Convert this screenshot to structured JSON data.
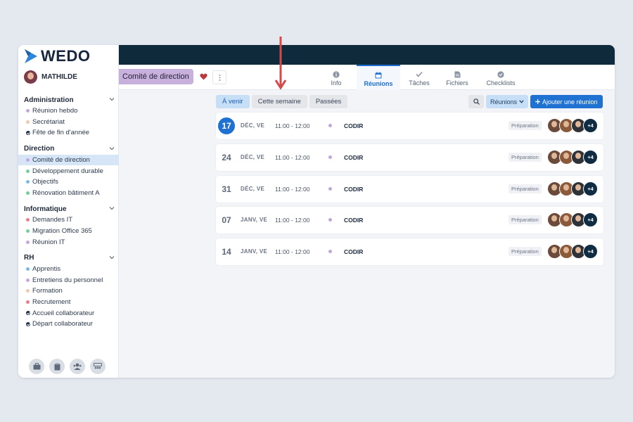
{
  "app": {
    "logo_text": "WEDO",
    "user_name": "MATHILDE"
  },
  "sidebar": {
    "groups": [
      {
        "title": "Administration",
        "items": [
          {
            "label": "Réunion hebdo",
            "marker": "dot",
            "color": "#c9a6df"
          },
          {
            "label": "Secrétariat",
            "marker": "dot",
            "color": "#f2c9a4"
          },
          {
            "label": "Fête de fin d'année",
            "marker": "check",
            "color": "#1a2b45"
          }
        ]
      },
      {
        "title": "Direction",
        "items": [
          {
            "label": "Comité de direction",
            "marker": "dot",
            "color": "#c9a6df",
            "active": true
          },
          {
            "label": "Développement durable",
            "marker": "dot",
            "color": "#74cf9b"
          },
          {
            "label": "Objectifs",
            "marker": "dot",
            "color": "#7ab8ea"
          },
          {
            "label": "Rénovation bâtiment A",
            "marker": "dot",
            "color": "#74cf9b"
          }
        ]
      },
      {
        "title": "Informatique",
        "items": [
          {
            "label": "Demandes IT",
            "marker": "dot",
            "color": "#e57f8a"
          },
          {
            "label": "Migration Office 365",
            "marker": "dot",
            "color": "#74cf9b"
          },
          {
            "label": "Réunion IT",
            "marker": "dot",
            "color": "#c9a6df"
          }
        ]
      },
      {
        "title": "RH",
        "items": [
          {
            "label": "Apprentis",
            "marker": "dot",
            "color": "#7ab8ea"
          },
          {
            "label": "Entretiens du personnel",
            "marker": "dot",
            "color": "#c9a6df"
          },
          {
            "label": "Formation",
            "marker": "dot",
            "color": "#f2c9a4"
          },
          {
            "label": "Recrutement",
            "marker": "dot",
            "color": "#e57f8a"
          },
          {
            "label": "Accueil collaborateur",
            "marker": "check",
            "color": "#1a2b45"
          },
          {
            "label": "Départ collaborateur",
            "marker": "check",
            "color": "#1a2b45"
          }
        ]
      }
    ],
    "bottom_icons": [
      "briefcase-icon",
      "clipboard-icon",
      "users-icon",
      "team-icon"
    ]
  },
  "header": {
    "workspace_title": "Comité de direction",
    "tabs": [
      {
        "label": "Info",
        "icon": "info-icon"
      },
      {
        "label": "Réunions",
        "icon": "calendar-icon",
        "active": true
      },
      {
        "label": "Tâches",
        "icon": "check-icon"
      },
      {
        "label": "Fichiers",
        "icon": "file-icon"
      },
      {
        "label": "Checklists",
        "icon": "checklist-icon"
      }
    ]
  },
  "toolbar": {
    "filters": [
      {
        "label": "À venir",
        "active": true
      },
      {
        "label": "Cette semaine"
      },
      {
        "label": "Passées"
      }
    ],
    "reunions_dropdown": "Réunions",
    "add_button": "Ajouter une réunion"
  },
  "meetings": [
    {
      "day": "17",
      "month": "DÉC, VE",
      "time": "11:00 - 12:00",
      "title": "CODIR",
      "status": "Préparation",
      "extra": "+4",
      "today": true
    },
    {
      "day": "24",
      "month": "DÉC, VE",
      "time": "11:00 - 12:00",
      "title": "CODIR",
      "status": "Préparation",
      "extra": "+4"
    },
    {
      "day": "31",
      "month": "DÉC, VE",
      "time": "11:00 - 12:00",
      "title": "CODIR",
      "status": "Préparation",
      "extra": "+4"
    },
    {
      "day": "07",
      "month": "JANV, VE",
      "time": "11:00 - 12:00",
      "title": "CODIR",
      "status": "Préparation",
      "extra": "+4"
    },
    {
      "day": "14",
      "month": "JANV, VE",
      "time": "11:00 - 12:00",
      "title": "CODIR",
      "status": "Préparation",
      "extra": "+4"
    }
  ],
  "colors": {
    "accent": "#1f72d1",
    "topbar": "#0f2a3b",
    "annotation_arrow": "#d5494a"
  }
}
